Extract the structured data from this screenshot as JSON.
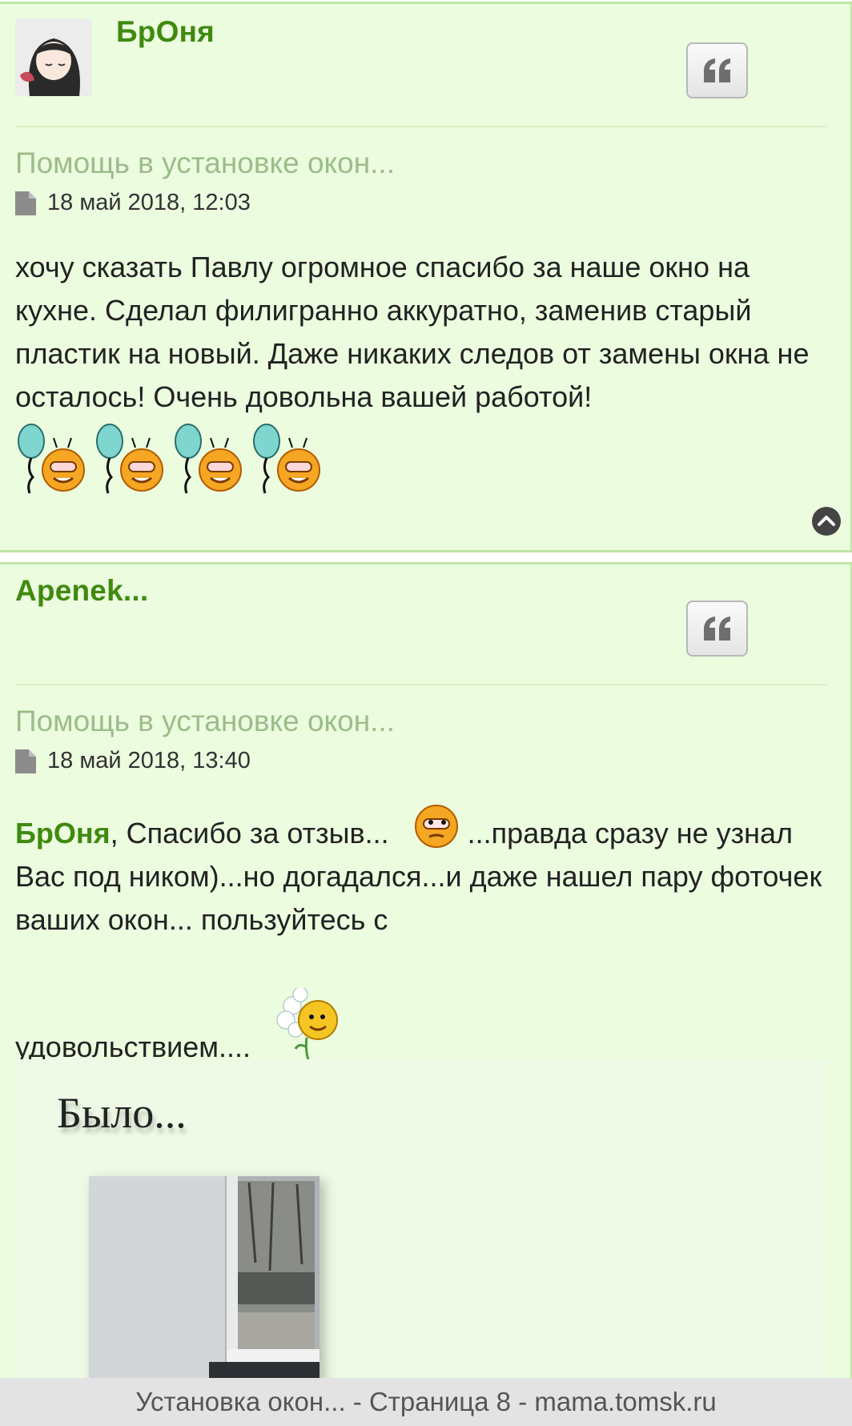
{
  "posts": [
    {
      "author": "БрОня",
      "topic": "Помощь в установке окон...",
      "date": "18 май 2018, 12:03",
      "text": "хочу сказать Павлу огромное спасибо за наше окно на кухне. Сделал филигранно аккуратно, заменив старый пластик на новый. Даже никаких следов от замены окна не осталось! Очень довольна вашей работой!"
    },
    {
      "author": "Apenek...",
      "topic": "Помощь в установке окон...",
      "date": "18 май 2018, 13:40",
      "mention": "БрОня",
      "text_part1": ", Спасибо за отзыв...",
      "text_part2": " ...правда сразу не узнал Вас под ником)...но догадался...и даже нашел пару фоточек ваших окон... пользуйтесь с",
      "text_part3": "удовольствием....",
      "photo_label": "Было..."
    }
  ],
  "icons": {
    "quote": "quote-icon",
    "post": "file-icon",
    "top": "chevron-up-icon",
    "emoji": "balloon-smiley-icon"
  },
  "colors": {
    "post_bg": "#ebfcdf",
    "border": "#bfe6a6",
    "author": "#3f8a0f",
    "topic": "#9cbc8a"
  },
  "statusbar": "Установка окон... - Страница 8 - mama.tomsk.ru"
}
